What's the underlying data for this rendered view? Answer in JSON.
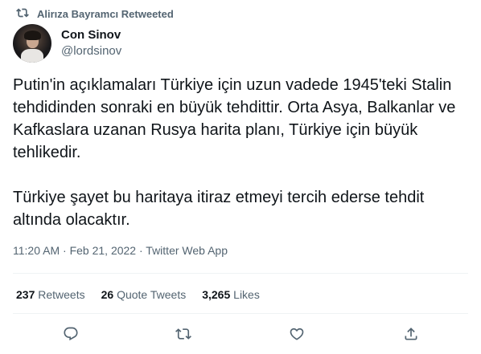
{
  "retweet_context": {
    "text": "Alirıza Bayramcı Retweeted"
  },
  "author": {
    "display_name": "Con Sinov",
    "handle": "@lordsinov"
  },
  "tweet": {
    "paragraphs": [
      "Putin'in açıklamaları Türkiye için uzun vadede 1945'teki Stalin tehdidinden sonraki en büyük tehdittir. Orta Asya, Balkanlar ve Kafkaslara uzanan Rusya harita planı, Türkiye için büyük tehlikedir.",
      "Türkiye şayet bu haritaya itiraz etmeyi tercih ederse tehdit altında olacaktır."
    ],
    "time": "11:20 AM",
    "date": "Feb 21, 2022",
    "source": "Twitter Web App"
  },
  "stats": {
    "retweets": {
      "count": "237",
      "label": "Retweets"
    },
    "quote_tweets": {
      "count": "26",
      "label": "Quote Tweets"
    },
    "likes": {
      "count": "3,265",
      "label": "Likes"
    }
  },
  "actions": [
    "reply-icon",
    "retweet-icon",
    "like-icon",
    "share-icon"
  ],
  "colors": {
    "text": "#0f1419",
    "secondary": "#536471",
    "divider": "#eff3f4"
  }
}
